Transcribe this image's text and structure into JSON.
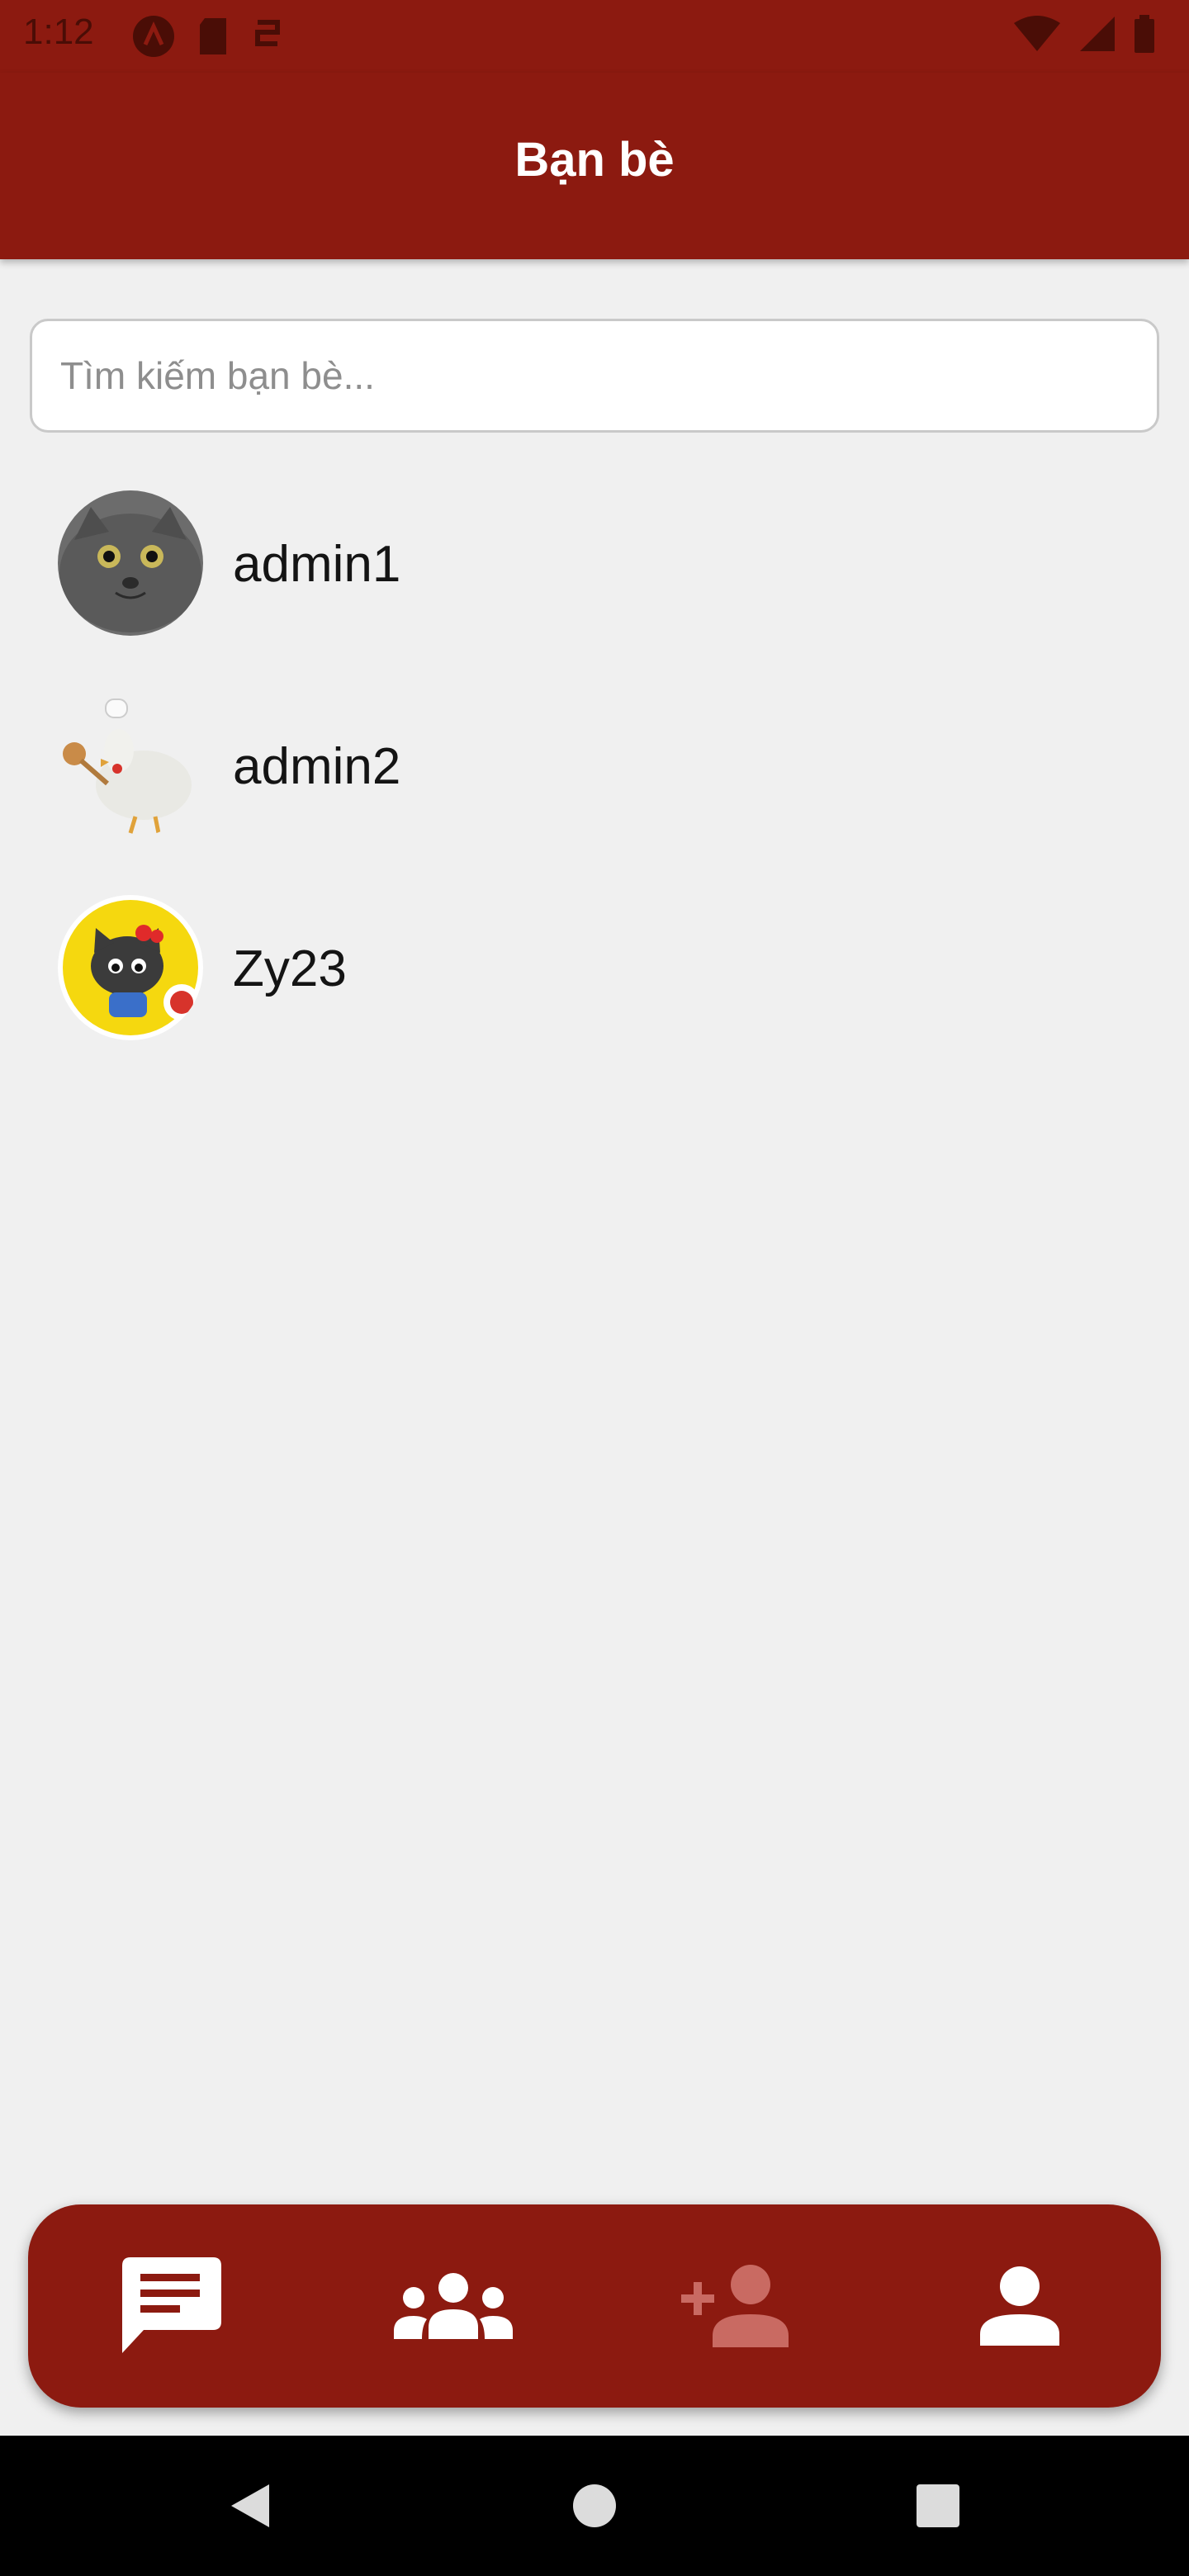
{
  "status_bar": {
    "time": "1:12",
    "icons_left": [
      "autofill-icon",
      "sd-card-icon",
      "sync-icon"
    ],
    "icons_right": [
      "wifi-icon",
      "signal-icon",
      "battery-icon"
    ]
  },
  "header": {
    "title": "Bạn bè"
  },
  "search": {
    "placeholder": "Tìm kiếm bạn bè...",
    "value": ""
  },
  "friends": [
    {
      "name": "admin1",
      "avatar": "cat-avatar"
    },
    {
      "name": "admin2",
      "avatar": "chef-chicken-avatar"
    },
    {
      "name": "Zy23",
      "avatar": "cartoon-cat-avatar"
    }
  ],
  "bottom_nav": {
    "items": [
      {
        "icon": "chat-icon",
        "active": true
      },
      {
        "icon": "friends-group-icon",
        "active": true
      },
      {
        "icon": "add-friend-icon",
        "active": false
      },
      {
        "icon": "profile-icon",
        "active": true
      }
    ]
  },
  "system_nav": [
    "back-icon",
    "home-icon",
    "recents-icon"
  ],
  "colors": {
    "primary": "#8c1a10",
    "background": "#f0f0f0",
    "text": "#141414",
    "placeholder": "#8e8e8e",
    "inactive_icon": "#c96a62"
  }
}
